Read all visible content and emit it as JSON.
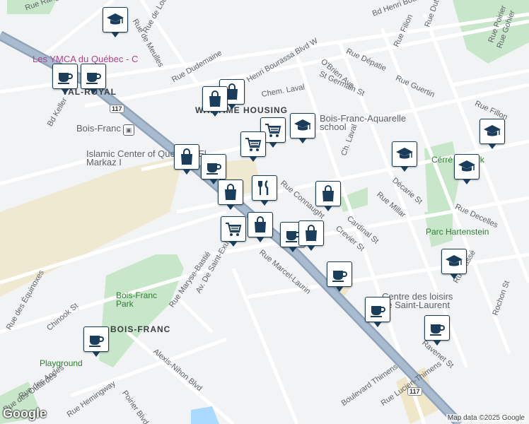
{
  "map": {
    "neighborhoods": [
      "VAL-ROYAL",
      "WARTIME HOUSING",
      "BOIS-FRANC"
    ],
    "streets": [
      "Rue Ranger",
      "Rue de Meulles",
      "Rue de Louisbourg",
      "Rue Dudemaine",
      "Bd Keller",
      "Henri Bourassa Blvd W",
      "O'Brien Ave",
      "Bd Henri Bourassa",
      "Rue Dutrisac",
      "Rue Poirier",
      "Rue Filion",
      "Rue Dépatie",
      "St Germain St",
      "Rue Guertin",
      "Rue Fillon",
      "Chem. Laval",
      "Rue Connaught",
      "Cardinal St",
      "Crevier St",
      "Rue Millar",
      "Décarie St",
      "Rue Marcel-Laurin",
      "Av. De Saint-Exupéry",
      "Rue Maryse-Bastié",
      "Rue des Équinoxes",
      "Chinook St",
      "Alexis-Nihon Blvd",
      "Rue des Outardes",
      "Rue des Andes",
      "Poirier Blvd",
      "Rue Hemingway",
      "Boulevard Thimens",
      "Rue Lucien-Thimens",
      "Rochon St",
      "Rue Tassé",
      "Rue Gohier",
      "Rue Decelles",
      "Ravenet St",
      "Ch. Laval"
    ],
    "pois": [
      "Les YMCA du Québec - C",
      "Bois-Franc",
      "Islamic Center of Quebec - El Markaz I",
      "Bois-Franc-Aquarelle school",
      "Parc Hartenstein",
      "Centre des loisirs de Saint-Laurent",
      "Bois-Franc Park",
      "Playground",
      "Cérré au Park"
    ],
    "route_shield": "117",
    "logo": "Google",
    "attribution": "Map data ©2025 Google"
  },
  "markers": [
    {
      "type": "school-icon"
    },
    {
      "type": "cafe-icon"
    },
    {
      "type": "cafe-icon"
    },
    {
      "type": "shopping-bag-icon"
    },
    {
      "type": "shopping-bag-icon"
    },
    {
      "type": "grocery-cart-icon"
    },
    {
      "type": "school-icon"
    },
    {
      "type": "grocery-cart-icon"
    },
    {
      "type": "shopping-bag-icon"
    },
    {
      "type": "cafe-icon"
    },
    {
      "type": "shopping-bag-icon"
    },
    {
      "type": "restaurant-icon"
    },
    {
      "type": "shopping-bag-icon"
    },
    {
      "type": "school-icon"
    },
    {
      "type": "school-icon"
    },
    {
      "type": "grocery-cart-icon"
    },
    {
      "type": "cafe-icon"
    },
    {
      "type": "shopping-bag-icon"
    },
    {
      "type": "cafe-icon"
    },
    {
      "type": "cafe-icon"
    },
    {
      "type": "cafe-icon"
    },
    {
      "type": "shopping-bag-icon"
    },
    {
      "type": "school-icon"
    },
    {
      "type": "school-icon"
    },
    {
      "type": "cafe-icon"
    }
  ]
}
